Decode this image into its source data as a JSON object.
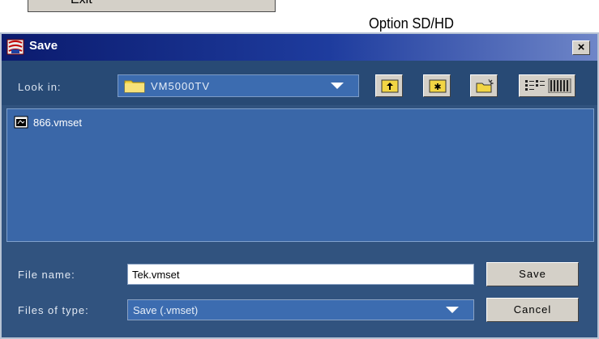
{
  "background_menu": {
    "item_label": "Exit"
  },
  "caption": "Option SD/HD",
  "dialog": {
    "title": "Save",
    "title_icon": "save-app-icon",
    "close_glyph": "×",
    "look_in": {
      "label": "Look in:",
      "value": "VM5000TV"
    },
    "toolbar_buttons": [
      {
        "name": "up-one-level-button",
        "icon": "folder-up-icon"
      },
      {
        "name": "desktop-button",
        "icon": "desktop-folder-icon"
      },
      {
        "name": "create-new-folder-button",
        "icon": "new-folder-icon"
      },
      {
        "name": "view-menu-button",
        "icon": "view-list-details-icon"
      }
    ],
    "files": [
      {
        "name": "866.vmset",
        "icon": "vmset-file-icon"
      }
    ],
    "file_name": {
      "label": "File name:",
      "value": "Tek.vmset"
    },
    "files_of_type": {
      "label": "Files of type:",
      "value": "Save (.vmset)"
    },
    "save_button": "Save",
    "cancel_button": "Cancel"
  },
  "colors": {
    "dialog_bg": "#31537f",
    "title_gradient_start": "#0b1b6e",
    "list_bg": "#3a67a8",
    "button_face": "#d4d0c8"
  }
}
